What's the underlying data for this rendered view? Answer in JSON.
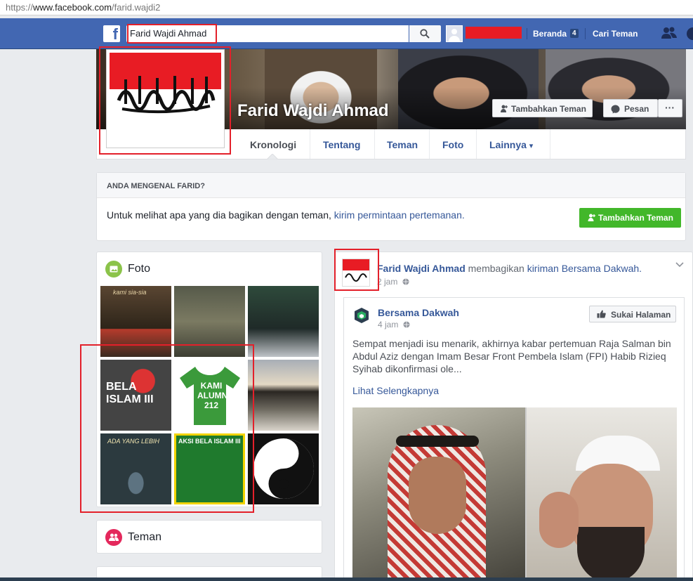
{
  "browser": {
    "url_prefix": "https://",
    "url_host": "www.facebook.com",
    "url_path": "/farid.wajdi2"
  },
  "topbar": {
    "logo": "f",
    "search_value": "Farid Wajdi Ahmad",
    "nav_home": "Beranda",
    "home_badge": "4",
    "nav_find_friends": "Cari Teman",
    "colors": {
      "bar": "#4267b2",
      "redaction": "#e81c24"
    }
  },
  "profile": {
    "name": "Farid Wajdi Ahmad",
    "add_friend": "Tambahkan Teman",
    "message": "Pesan",
    "more": "···",
    "tabs": [
      "Kronologi",
      "Tentang",
      "Teman",
      "Foto",
      "Lainnya"
    ],
    "tab_more_arrow": "▾"
  },
  "know_card": {
    "header": "ANDA MENGENAL FARID?",
    "text": "Untuk melihat apa yang dia bagikan dengan teman,",
    "link": "kirim permintaan pertemanan.",
    "button": "Tambahkan Teman"
  },
  "photos": {
    "title": "Foto",
    "items": [
      {
        "icon": "photo-thumb-1",
        "caption": "kami sia-sia"
      },
      {
        "icon": "photo-thumb-2",
        "caption": ""
      },
      {
        "icon": "photo-thumb-3",
        "caption": ""
      },
      {
        "icon": "photo-thumb-4",
        "caption": "BELA ISLAM III"
      },
      {
        "icon": "photo-thumb-5",
        "caption": "KAMI ALUMNI 212"
      },
      {
        "icon": "photo-thumb-6",
        "caption": ""
      },
      {
        "icon": "photo-thumb-7",
        "caption": "ADA YANG LEBIH"
      },
      {
        "icon": "photo-thumb-8",
        "caption": "AKSI BELA ISLAM III"
      },
      {
        "icon": "photo-thumb-9",
        "caption": ""
      }
    ]
  },
  "friends_section": {
    "title": "Teman"
  },
  "post": {
    "author": "Farid Wajdi Ahmad",
    "action": "membagikan",
    "shared_link": "kiriman Bersama Dakwah.",
    "time": "2 jam",
    "shared": {
      "page_name": "Bersama Dakwah",
      "time": "4 jam",
      "like_button": "Sukai Halaman",
      "text": "Sempat menjadi isu menarik, akhirnya kabar pertemuan Raja Salman bin Abdul Aziz dengan Imam Besar Front Pembela Islam (FPI) Habib Rizieq Syihab dikonfirmasi ole...",
      "see_more": "Lihat Selengkapnya"
    }
  }
}
